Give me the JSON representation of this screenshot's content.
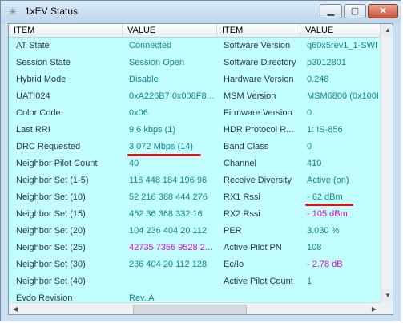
{
  "window": {
    "title": "1xEV Status"
  },
  "header": {
    "item": "ITEM",
    "value": "VALUE",
    "item2": "ITEM",
    "value2": "VALUE"
  },
  "colors": {
    "value_text": "#14888a",
    "highlight_value": "#d10fd1",
    "panel_bg": "#c2fefe",
    "annotation": "#e0111a"
  },
  "rows": [
    {
      "k1": "AT State",
      "v1": "Connected",
      "k2": "Software Version",
      "v2": "q60x5rev1_1-SWI"
    },
    {
      "k1": "Session State",
      "v1": "Session Open",
      "k2": "Software Directory",
      "v2": "p3012801"
    },
    {
      "k1": "Hybrid Mode",
      "v1": "Disable",
      "k2": "Hardware Version",
      "v2": "0.248"
    },
    {
      "k1": "UATI024",
      "v1": "0xA226B7 0x008F8...",
      "k2": "MSM Version",
      "v2": "MSM6800 (0x100I"
    },
    {
      "k1": "Color Code",
      "v1": "0x06",
      "k2": "Firmware Version",
      "v2": "0"
    },
    {
      "k1": "Last RRI",
      "v1": "9.6 kbps (1)",
      "k2": "HDR Protocol R...",
      "v2": "1: IS-856"
    },
    {
      "k1": "DRC Requested",
      "v1": "3.072 Mbps (14)",
      "k2": "Band Class",
      "v2": "0"
    },
    {
      "k1": "Neighbor Pilot Count",
      "v1": "40",
      "k2": "Channel",
      "v2": "410"
    },
    {
      "k1": "Neighbor Set (1-5)",
      "v1": "116 448 184 196 96",
      "k2": "Receive Diversity",
      "v2": "Active (on)"
    },
    {
      "k1": "Neighbor Set (10)",
      "v1": "52 216 388 444 276",
      "k2": "RX1 Rssi",
      "v2": "- 62 dBm"
    },
    {
      "k1": "Neighbor Set (15)",
      "v1": "452 36 368 332 16",
      "k2": "RX2 Rssi",
      "v2": "- 105 dBm"
    },
    {
      "k1": "Neighbor Set (20)",
      "v1": "104 236 404 20 112",
      "k2": "PER",
      "v2": "3.030 %"
    },
    {
      "k1": "Neighbor Set (25)",
      "v1": "42735 7356 9528 2...",
      "k2": "Active Pilot PN",
      "v2": "108"
    },
    {
      "k1": "Neighbor Set (30)",
      "v1": "236 404 20 112 128",
      "k2": "Ec/Io",
      "v2": "- 2.78 dB"
    },
    {
      "k1": "Neighbor Set (40)",
      "v1": "",
      "k2": "Active Pilot Count",
      "v2": "1"
    },
    {
      "k1": "Evdo Revision",
      "v1": "Rev. A",
      "k2": "",
      "v2": ""
    }
  ]
}
